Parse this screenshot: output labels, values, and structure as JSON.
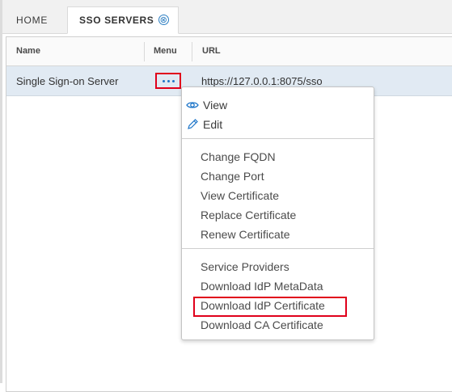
{
  "tabs": {
    "home_label": "HOME",
    "active_label": "SSO SERVERS",
    "close_glyph": "⊗"
  },
  "grid": {
    "columns": [
      "Name",
      "Menu",
      "URL"
    ],
    "rows": [
      {
        "name": "Single Sign-on Server",
        "url": "https://127.0.0.1:8075/sso"
      }
    ]
  },
  "menu": {
    "view_label": "View",
    "edit_label": "Edit",
    "group1": [
      "Change FQDN",
      "Change Port",
      "View Certificate",
      "Replace Certificate",
      "Renew Certificate"
    ],
    "group2": [
      "Service Providers",
      "Download IdP MetaData",
      "Download IdP Certificate",
      "Download CA Certificate"
    ]
  },
  "colors": {
    "accent": "#1f76c9",
    "highlight": "#e0001b",
    "row_selected": "#e1eaf3"
  }
}
